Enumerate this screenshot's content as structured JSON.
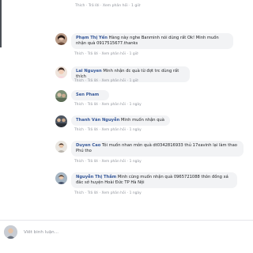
{
  "top_meta": {
    "like": "Thích",
    "reply": "Trả lời",
    "edit_history": "Xem phản hồi",
    "time": "1 giờ"
  },
  "comments": [
    {
      "name": "Phạm Thị Yến",
      "text": "Hàng này nghe Banminh nói dùng rất Ok! Minh muốn nhận quà 0917515677.thanks",
      "like": "Thích",
      "reply": "Trả lời",
      "more": "Xem phản hồi",
      "time": "1 giờ"
    },
    {
      "name": "Lai Nguyen",
      "text": "Minh nhận đc quà từ đợt trc dùng rất thích",
      "like": "Thích",
      "reply": "Trả lời",
      "more": "Xem phản hồi",
      "time": "1 giờ"
    },
    {
      "name": "Sen Pham",
      "text": "",
      "like": "Thích",
      "reply": "Trả lời",
      "more": "Xem phản hồi",
      "time": "1 ngày"
    },
    {
      "name": "Thanh Văn Nguyễn",
      "text": "Minh muốn nhận quà",
      "like": "Thích",
      "reply": "Trả lời",
      "more": "Xem phản hồi",
      "time": "1 ngày"
    },
    {
      "name": "Duyen Cao",
      "text": "Tôi muốn nhan môn quà dt0342816933 thủ 17xavinh lại làm thao Phú tho",
      "like": "Thích",
      "reply": "Trả lời",
      "more": "Xem phản hồi",
      "time": "1 ngày"
    },
    {
      "name": "Nguyễn Thị Thắm",
      "text": "Minh cũng muốn nhận quà 0965721088 thôn đồng xá đắc sở huyện Hoài Đức TP Hà Nội",
      "like": "Thích",
      "reply": "Trả lời",
      "more": "Xem phản hồi",
      "time": "1 ngày"
    }
  ],
  "composer": {
    "placeholder": "Viết bình luận..."
  },
  "colors": {
    "name_link": "#365899",
    "bubble_bg": "#f2f3f5",
    "meta": "#90949c"
  }
}
